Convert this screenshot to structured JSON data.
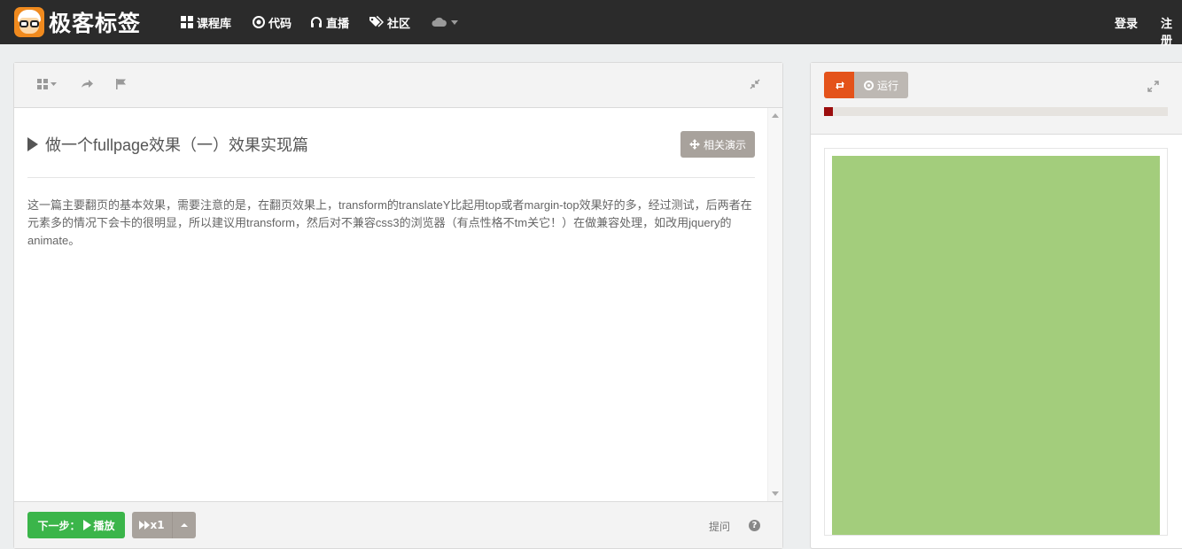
{
  "navbar": {
    "brand": "极客标签",
    "items": [
      {
        "label": "课程库",
        "icon": "grid-icon"
      },
      {
        "label": "代码",
        "icon": "target-icon"
      },
      {
        "label": "直播",
        "icon": "headphones-icon"
      },
      {
        "label": "社区",
        "icon": "tags-icon"
      }
    ],
    "cloud_icon": "cloud-icon",
    "login": "登录",
    "register": "注册"
  },
  "left_panel": {
    "toolbar_icons": [
      "grid-dropdown-icon",
      "share-icon",
      "flag-icon",
      "collapse-icon"
    ],
    "title": "做一个fullpage效果（一）效果实现篇",
    "demo_button": "相关演示",
    "description": "这一篇主要翻页的基本效果，需要注意的是，在翻页效果上，transform的translateY比起用top或者margin-top效果好的多，经过测试，后两者在元素多的情况下会卡的很明显，所以建议用transform，然后对不兼容css3的浏览器（有点性格不tm关它！）在做兼容处理，如改用jquery的animate。",
    "next_button_prefix": "下一步：",
    "next_button_action": "播放",
    "speed_label": "x1",
    "hint_label": "提问",
    "help_glyph": "?"
  },
  "right_panel": {
    "run_label": "运行",
    "progress": 0.025,
    "preview_color": "#a3cd7c"
  },
  "colors": {
    "navbar": "#2b2b2b",
    "brand_orange": "#f08a1e",
    "next_green": "#3bb54a",
    "refresh_red": "#e4531b",
    "progress_fill": "#9b0d0d"
  }
}
